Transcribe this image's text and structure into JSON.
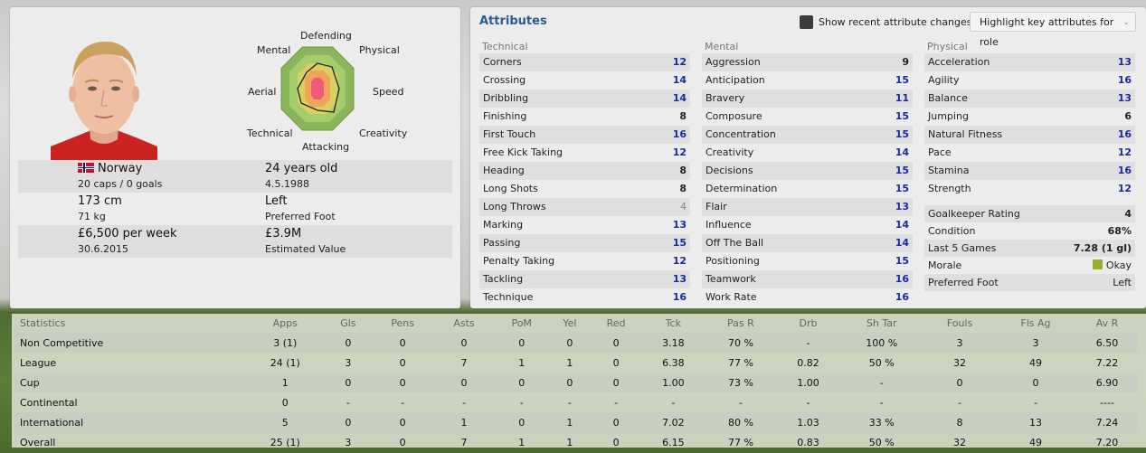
{
  "player": {
    "nationality": "Norway",
    "caps_goals": "20 caps / 0 goals",
    "age": "24 years old",
    "dob": "4.5.1988",
    "height": "173 cm",
    "weight": "71 kg",
    "foot": "Left",
    "foot_label": "Preferred Foot",
    "wage": "£6,500 per week",
    "contract_end": "30.6.2015",
    "value": "£3.9M",
    "value_label": "Estimated Value"
  },
  "radar": {
    "labels": {
      "defending": "Defending",
      "physical": "Physical",
      "speed": "Speed",
      "creativity": "Creativity",
      "attacking": "Attacking",
      "technical": "Technical",
      "aerial": "Aerial",
      "mental": "Mental"
    }
  },
  "attributes": {
    "title": "Attributes",
    "recent_toggle": "Show recent attribute changes",
    "highlight_button": "Highlight key attributes for role",
    "technical": {
      "heading": "Technical",
      "items": [
        {
          "name": "Corners",
          "value": "12"
        },
        {
          "name": "Crossing",
          "value": "14"
        },
        {
          "name": "Dribbling",
          "value": "14"
        },
        {
          "name": "Finishing",
          "value": "8"
        },
        {
          "name": "First Touch",
          "value": "16"
        },
        {
          "name": "Free Kick Taking",
          "value": "12"
        },
        {
          "name": "Heading",
          "value": "8"
        },
        {
          "name": "Long Shots",
          "value": "8"
        },
        {
          "name": "Long Throws",
          "value": "4"
        },
        {
          "name": "Marking",
          "value": "13"
        },
        {
          "name": "Passing",
          "value": "15"
        },
        {
          "name": "Penalty Taking",
          "value": "12"
        },
        {
          "name": "Tackling",
          "value": "13"
        },
        {
          "name": "Technique",
          "value": "16"
        }
      ]
    },
    "mental": {
      "heading": "Mental",
      "items": [
        {
          "name": "Aggression",
          "value": "9"
        },
        {
          "name": "Anticipation",
          "value": "15"
        },
        {
          "name": "Bravery",
          "value": "11"
        },
        {
          "name": "Composure",
          "value": "15"
        },
        {
          "name": "Concentration",
          "value": "15"
        },
        {
          "name": "Creativity",
          "value": "14"
        },
        {
          "name": "Decisions",
          "value": "15"
        },
        {
          "name": "Determination",
          "value": "15"
        },
        {
          "name": "Flair",
          "value": "13"
        },
        {
          "name": "Influence",
          "value": "14"
        },
        {
          "name": "Off The Ball",
          "value": "14"
        },
        {
          "name": "Positioning",
          "value": "15"
        },
        {
          "name": "Teamwork",
          "value": "16"
        },
        {
          "name": "Work Rate",
          "value": "16"
        }
      ]
    },
    "physical": {
      "heading": "Physical",
      "items": [
        {
          "name": "Acceleration",
          "value": "13"
        },
        {
          "name": "Agility",
          "value": "16"
        },
        {
          "name": "Balance",
          "value": "13"
        },
        {
          "name": "Jumping",
          "value": "6"
        },
        {
          "name": "Natural Fitness",
          "value": "16"
        },
        {
          "name": "Pace",
          "value": "12"
        },
        {
          "name": "Stamina",
          "value": "16"
        },
        {
          "name": "Strength",
          "value": "12"
        }
      ],
      "status": [
        {
          "name": "Goalkeeper Rating",
          "value": "4"
        },
        {
          "name": "Condition",
          "value": "68%"
        },
        {
          "name": "Last 5 Games",
          "value": "7.28 (1 gl)"
        },
        {
          "name": "Morale",
          "value": "Okay"
        },
        {
          "name": "Preferred Foot",
          "value": "Left"
        }
      ]
    }
  },
  "stats": {
    "headers": [
      "Statistics",
      "Apps",
      "Gls",
      "Pens",
      "Asts",
      "PoM",
      "Yel",
      "Red",
      "Tck",
      "Pas R",
      "Drb",
      "Sh Tar",
      "Fouls",
      "Fls Ag",
      "Av R"
    ],
    "rows": [
      [
        "Non Competitive",
        "3 (1)",
        "0",
        "0",
        "0",
        "0",
        "0",
        "0",
        "3.18",
        "70 %",
        "-",
        "100 %",
        "3",
        "3",
        "6.50"
      ],
      [
        "League",
        "24 (1)",
        "3",
        "0",
        "7",
        "1",
        "1",
        "0",
        "6.38",
        "77 %",
        "0.82",
        "50 %",
        "32",
        "49",
        "7.22"
      ],
      [
        "Cup",
        "1",
        "0",
        "0",
        "0",
        "0",
        "0",
        "0",
        "1.00",
        "73 %",
        "1.00",
        "-",
        "0",
        "0",
        "6.90"
      ],
      [
        "Continental",
        "0",
        "-",
        "-",
        "-",
        "-",
        "-",
        "-",
        "-",
        "-",
        "-",
        "-",
        "-",
        "-",
        "----"
      ],
      [
        "International",
        "5",
        "0",
        "0",
        "1",
        "0",
        "1",
        "0",
        "7.02",
        "80 %",
        "1.03",
        "33 %",
        "8",
        "13",
        "7.24"
      ],
      [
        "Overall",
        "25 (1)",
        "3",
        "0",
        "7",
        "1",
        "1",
        "0",
        "6.15",
        "77 %",
        "0.83",
        "50 %",
        "32",
        "49",
        "7.20"
      ]
    ]
  }
}
